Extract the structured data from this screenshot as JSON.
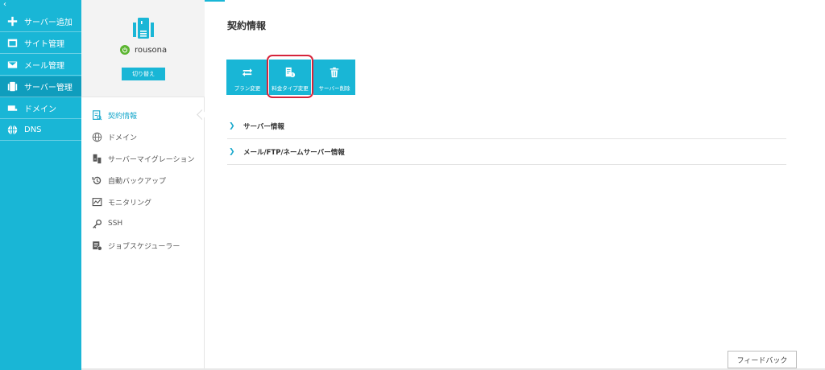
{
  "sidebar": {
    "collapse_glyph": "‹",
    "items": [
      {
        "label": "サーバー追加",
        "icon": "plus-icon"
      },
      {
        "label": "サイト管理",
        "icon": "window-icon"
      },
      {
        "label": "メール管理",
        "icon": "mail-icon"
      },
      {
        "label": "サーバー管理",
        "icon": "server-icon"
      },
      {
        "label": "ドメイン",
        "icon": "domain-icon"
      },
      {
        "label": "DNS",
        "icon": "globe-icon"
      }
    ]
  },
  "server": {
    "name": "rousona",
    "switch_label": "切り替え"
  },
  "submenu": [
    {
      "label": "契約情報",
      "icon": "contract-icon"
    },
    {
      "label": "ドメイン",
      "icon": "globe-icon"
    },
    {
      "label": "サーバーマイグレーション",
      "icon": "migration-icon"
    },
    {
      "label": "自動バックアップ",
      "icon": "backup-icon"
    },
    {
      "label": "モニタリング",
      "icon": "monitor-icon"
    },
    {
      "label": "SSH",
      "icon": "key-icon"
    },
    {
      "label": "ジョブスケジューラー",
      "icon": "scheduler-icon"
    }
  ],
  "main": {
    "title": "契約情報",
    "toolbar": {
      "plan_change": "プラン変更",
      "fee_type_change": "料金タイプ変更",
      "server_delete": "サーバー削除"
    },
    "sections": [
      {
        "label": "サーバー情報"
      },
      {
        "label": "メール/FTP/ネームサーバー情報"
      }
    ]
  },
  "feedback_label": "フィードバック",
  "colors": {
    "accent": "#19b6d6",
    "accent_dark": "#0f9dbd",
    "highlight": "#d6243b",
    "power": "#5cb531"
  }
}
